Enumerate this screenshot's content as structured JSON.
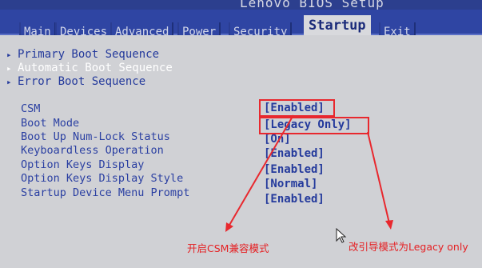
{
  "window_title": "Lenovo BIOS Setup",
  "tabs": [
    {
      "label": "Main"
    },
    {
      "label": "Devices"
    },
    {
      "label": "Advanced"
    },
    {
      "label": "Power"
    },
    {
      "label": "Security"
    },
    {
      "label": "Startup",
      "active": true
    },
    {
      "label": "Exit"
    }
  ],
  "menu": [
    {
      "label": "Primary Boot Sequence"
    },
    {
      "label": "Automatic Boot Sequence",
      "selected": true
    },
    {
      "label": "Error Boot Sequence"
    }
  ],
  "settings": [
    {
      "label": "CSM",
      "value": "[Enabled]"
    },
    {
      "label": "Boot Mode",
      "value": "[Legacy Only]"
    },
    {
      "label": "Boot Up Num-Lock Status",
      "value": "[On]"
    },
    {
      "label": "Keyboardless Operation",
      "value": "[Enabled]"
    },
    {
      "label": "Option Keys Display",
      "value": "[Enabled]"
    },
    {
      "label": "Option Keys Display Style",
      "value": "[Normal]"
    },
    {
      "label": "Startup Device Menu Prompt",
      "value": "[Enabled]"
    }
  ],
  "annotations": {
    "csm_note": "开启CSM兼容模式",
    "boot_mode_note": "改引导模式为Legacy only"
  },
  "colors": {
    "bios_blue": "#2f45a3",
    "text_blue": "#243a9c",
    "annotation_red": "#e8282e"
  }
}
